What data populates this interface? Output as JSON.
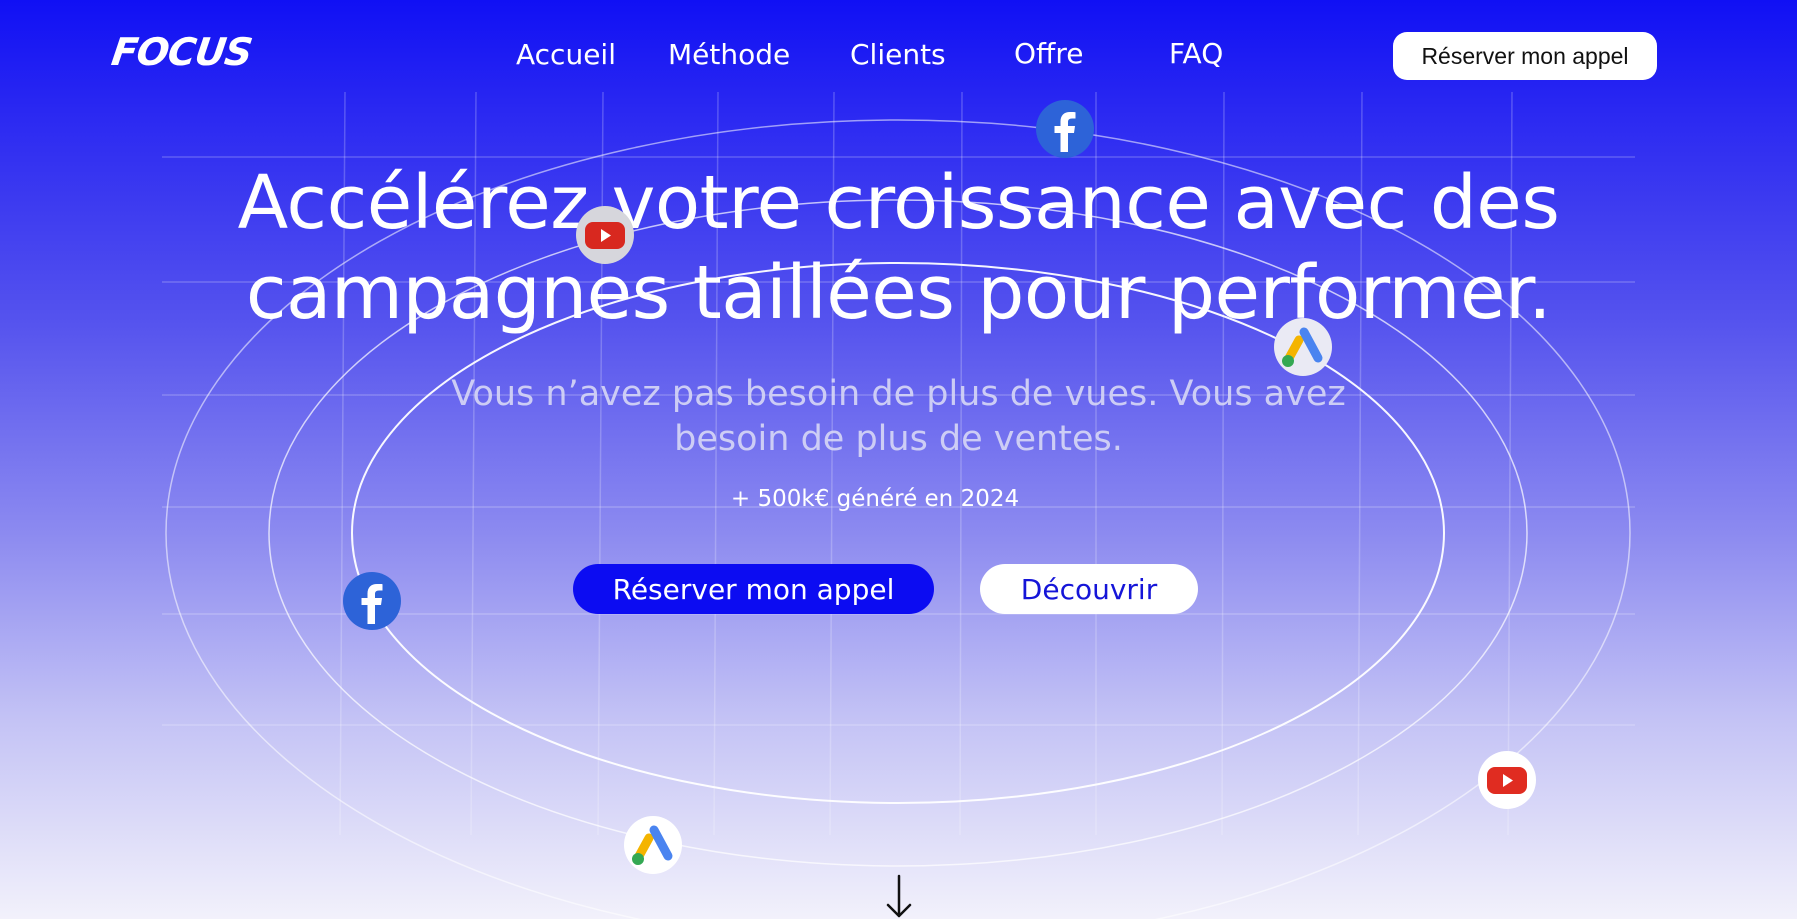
{
  "brand": {
    "logo": "FOCUS"
  },
  "nav": {
    "links": [
      "Accueil",
      "Méthode",
      "Clients",
      "Offre",
      "FAQ"
    ],
    "cta": "Réserver mon appel"
  },
  "hero": {
    "title_line1": "Accélérez votre croissance avec des",
    "title_line2": "campagnes taillées pour performer.",
    "subtitle_line1": "Vous n’avez pas besoin de plus de vues. Vous avez",
    "subtitle_line2": "besoin de plus de ventes.",
    "stat": "+ 500k€ généré en 2024",
    "primary_cta": "Réserver mon appel",
    "secondary_cta": "Découvrir"
  },
  "icons": {
    "facebook": "facebook-icon",
    "youtube": "youtube-icon",
    "google_ads": "google-ads-icon",
    "scroll": "arrow-down-icon"
  },
  "colors": {
    "primary_blue": "#0c0cf2",
    "facebook_blue": "#2d63d8",
    "youtube_red": "#e02c21",
    "text_white": "#ffffff"
  }
}
